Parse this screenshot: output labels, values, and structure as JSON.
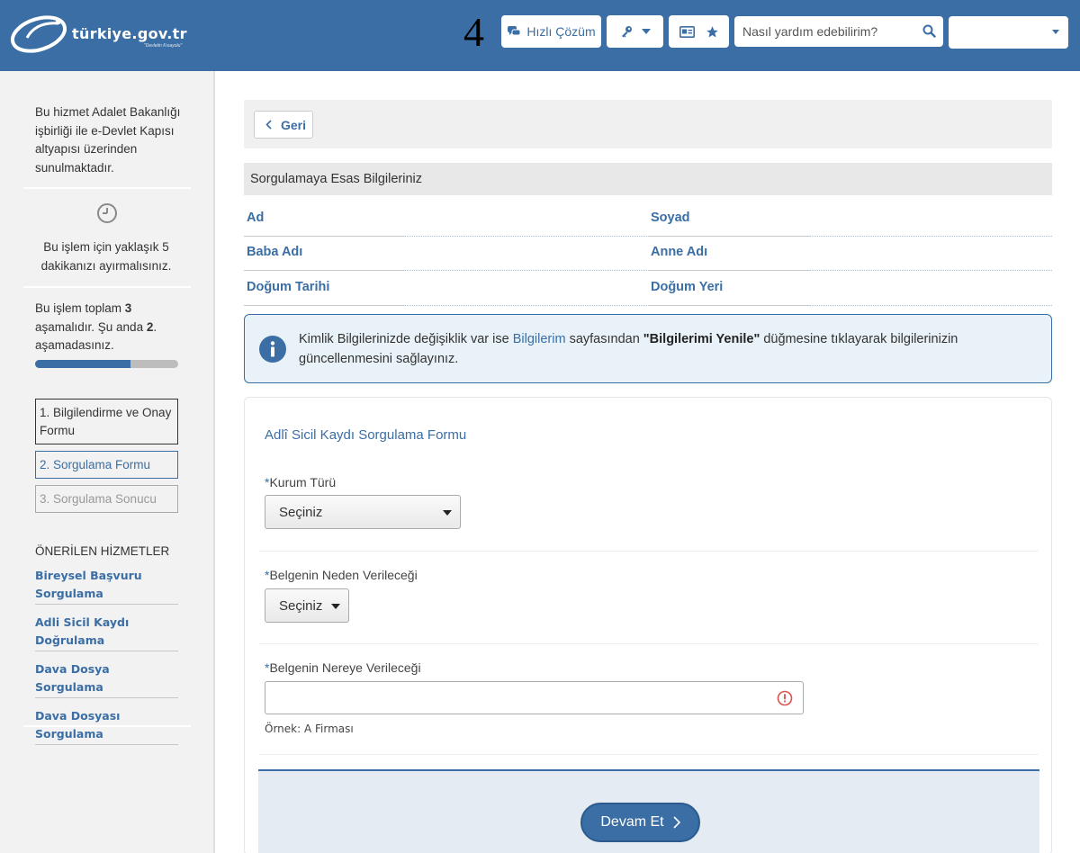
{
  "header": {
    "logo_text": "türkiye.gov.tr",
    "logo_slogan": "\"Devletin Kısayolu\"",
    "step_number": "4",
    "quick_solution_label": "Hızlı Çözüm",
    "search_placeholder": "Nasıl yardım edebilirim?",
    "user_menu_value": ""
  },
  "sidebar": {
    "service_info": "Bu hizmet Adalet Bakanlığı işbirliği ile e-Devlet Kapısı altyapısı üzerinden sunulmaktadır.",
    "time_info": "Bu işlem için yaklaşık 5 dakikanızı ayırmalısınız.",
    "stage_info": {
      "p1": "Bu işlem toplam ",
      "total": "3",
      "p2": " aşamalıdır. Şu anda ",
      "current": "2",
      "p3": ". aşamadasınız."
    },
    "progress_fraction": 0.667,
    "steps": [
      "1. Bilgilendirme ve Onay Formu",
      "2. Sorgulama Formu",
      "3. Sorgulama Sonucu"
    ],
    "recommended_title": "ÖNERİLEN HİZMETLER",
    "recommended": [
      "Bireysel Başvuru Sorgulama",
      "Adli Sicil Kaydı Doğrulama",
      "Dava Dosya Sorgulama",
      "Dava Dosyası Sorgulama"
    ]
  },
  "main": {
    "back_label": "Geri",
    "info_title": "Sorgulamaya Esas Bilgileriniz",
    "identity_fields": {
      "ad": "Ad",
      "soyad": "Soyad",
      "baba_adi": "Baba Adı",
      "anne_adi": "Anne Adı",
      "dogum_tarihi": "Doğum Tarihi",
      "dogum_yeri": "Doğum Yeri"
    },
    "alert": {
      "part1": "Kimlik Bilgilerinizde değişiklik var ise ",
      "link": "Bilgilerim",
      "part2": " sayfasından ",
      "bold": "\"Bilgilerimi Yenile\"",
      "part3": " düğmesine tıklayarak bilgilerinizin güncellenmesini sağlayınız."
    },
    "form": {
      "title": "Adlî Sicil Kaydı Sorgulama Formu",
      "required_mark": "*",
      "kurum_turu_label": "Kurum Türü",
      "kurum_turu_value": "Seçiniz",
      "neden_label": "Belgenin Neden Verileceği",
      "neden_value": "Seçiniz",
      "nereye_label": "Belgenin Nereye Verileceği",
      "nereye_value": "",
      "nereye_hint": "Örnek: A Firması",
      "submit_label": "Devam Et"
    }
  },
  "colors": {
    "brand": "#3b6ea5",
    "error": "#d9534f"
  }
}
